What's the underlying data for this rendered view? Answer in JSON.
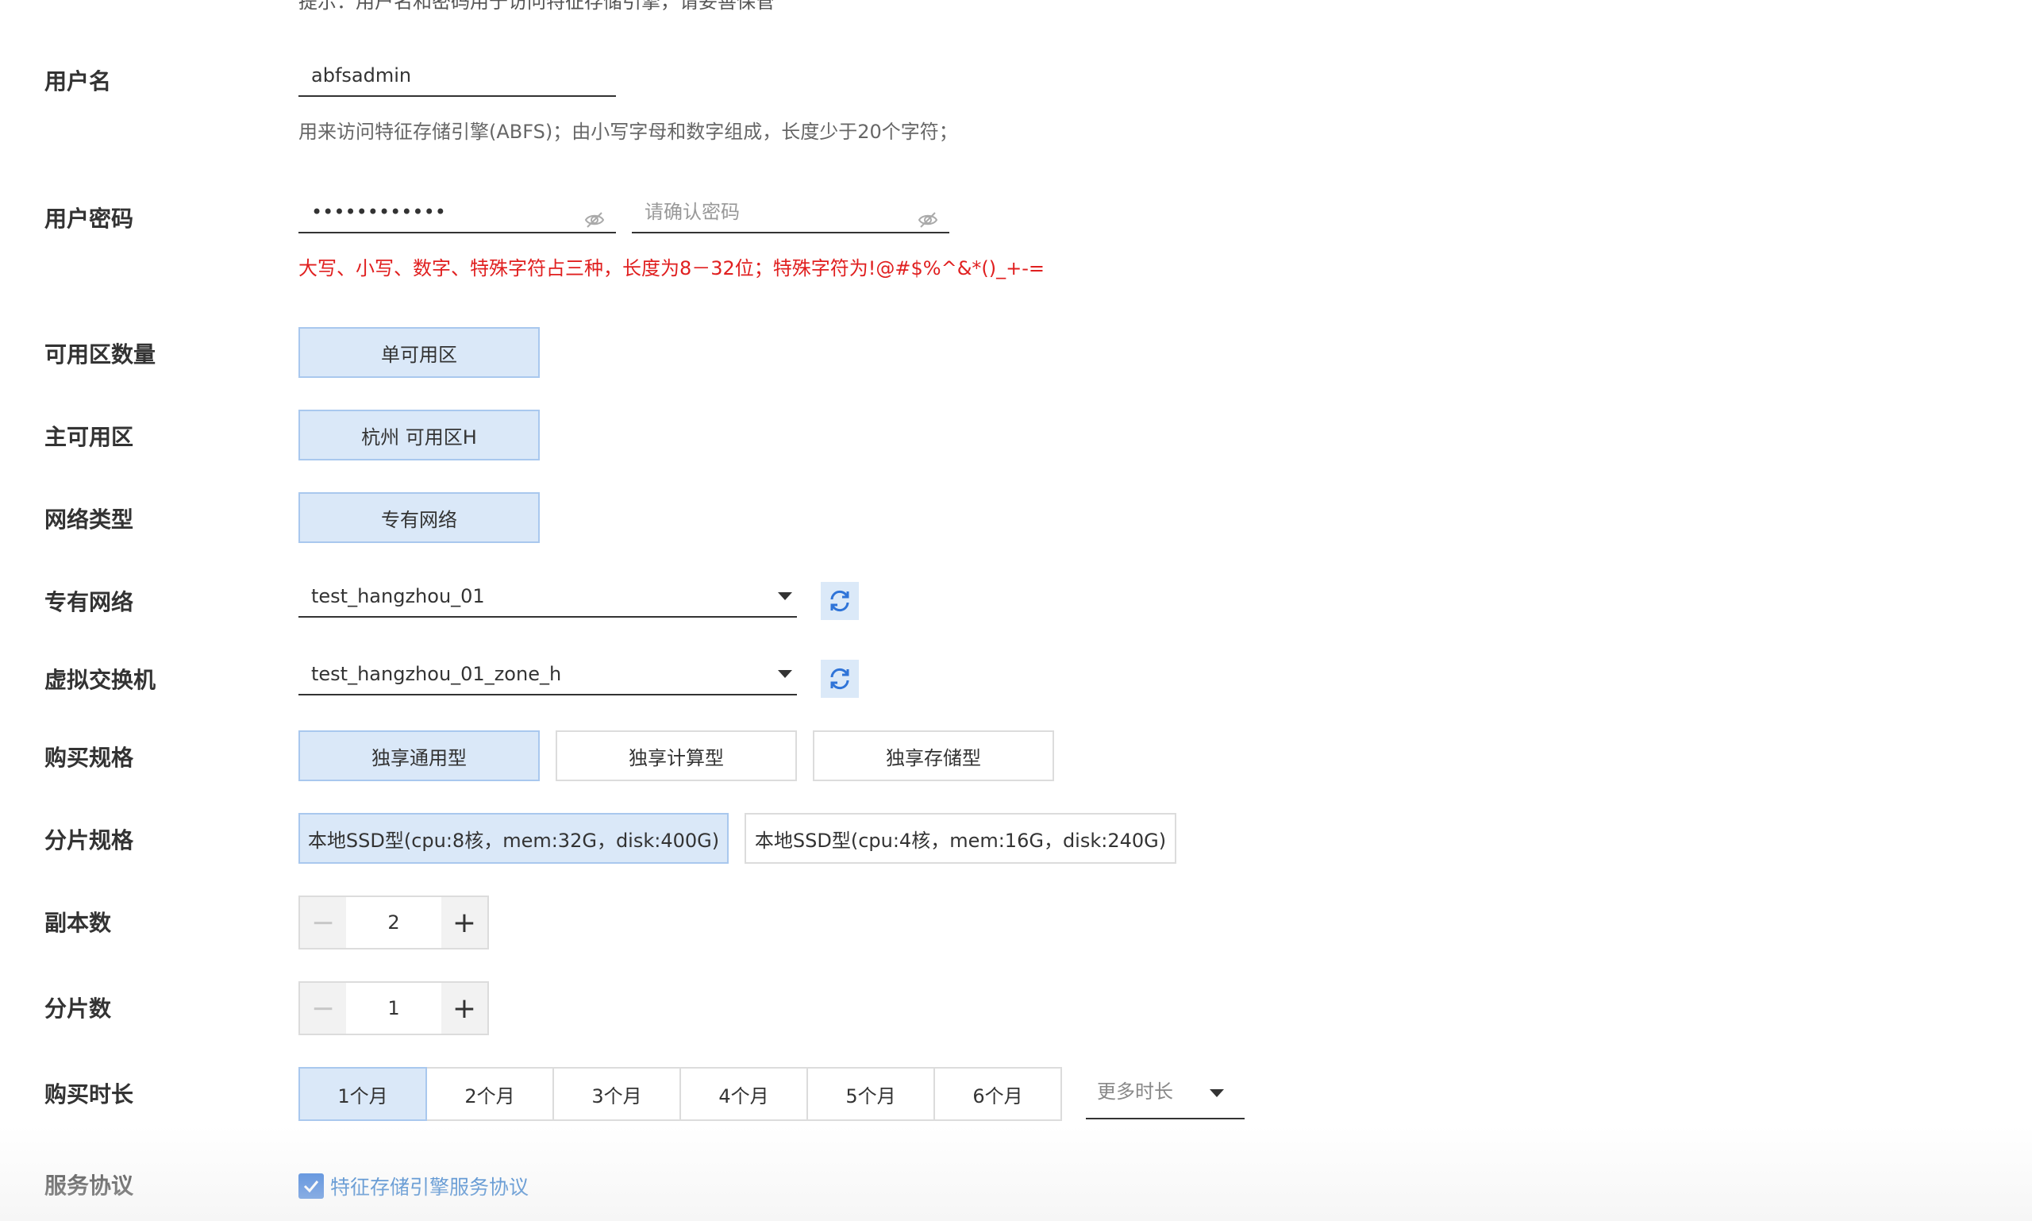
{
  "top_clipped_text": "提示：用户名和密码用于访问特征存储引擎，请妥善保管",
  "username": {
    "label": "用户名",
    "value": "abfsadmin",
    "help": "用来访问特征存储引擎(ABFS)；由小写字母和数字组成，长度少于20个字符；"
  },
  "password": {
    "label": "用户密码",
    "value": "••••••••••••",
    "confirm_placeholder": "请确认密码",
    "help": "大写、小写、数字、特殊字符占三种，长度为8－32位；特殊字符为!@#$%^&*()_+-="
  },
  "zone_count": {
    "label": "可用区数量",
    "options": [
      "单可用区"
    ],
    "selected": "单可用区"
  },
  "main_zone": {
    "label": "主可用区",
    "options": [
      "杭州 可用区H"
    ],
    "selected": "杭州 可用区H"
  },
  "network_type": {
    "label": "网络类型",
    "options": [
      "专有网络"
    ],
    "selected": "专有网络"
  },
  "vpc": {
    "label": "专有网络",
    "value": "test_hangzhou_01"
  },
  "vswitch": {
    "label": "虚拟交换机",
    "value": "test_hangzhou_01_zone_h"
  },
  "spec": {
    "label": "购买规格",
    "options": [
      "独享通用型",
      "独享计算型",
      "独享存储型"
    ],
    "selected": "独享通用型"
  },
  "shard_spec": {
    "label": "分片规格",
    "options": [
      "本地SSD型(cpu:8核，mem:32G，disk:400G)",
      "本地SSD型(cpu:4核，mem:16G，disk:240G)"
    ],
    "selected": "本地SSD型(cpu:8核，mem:32G，disk:400G)"
  },
  "replicas": {
    "label": "副本数",
    "value": "2"
  },
  "shards": {
    "label": "分片数",
    "value": "1"
  },
  "duration": {
    "label": "购买时长",
    "options": [
      "1个月",
      "2个月",
      "3个月",
      "4个月",
      "5个月",
      "6个月"
    ],
    "selected": "1个月",
    "more_label": "更多时长"
  },
  "agreement": {
    "label": "服务协议",
    "link": "特征存储引擎服务协议",
    "checked": true
  },
  "colors": {
    "accent": "#2f74d8",
    "selected_bg": "#dae8f8",
    "error": "#e01f1f"
  }
}
